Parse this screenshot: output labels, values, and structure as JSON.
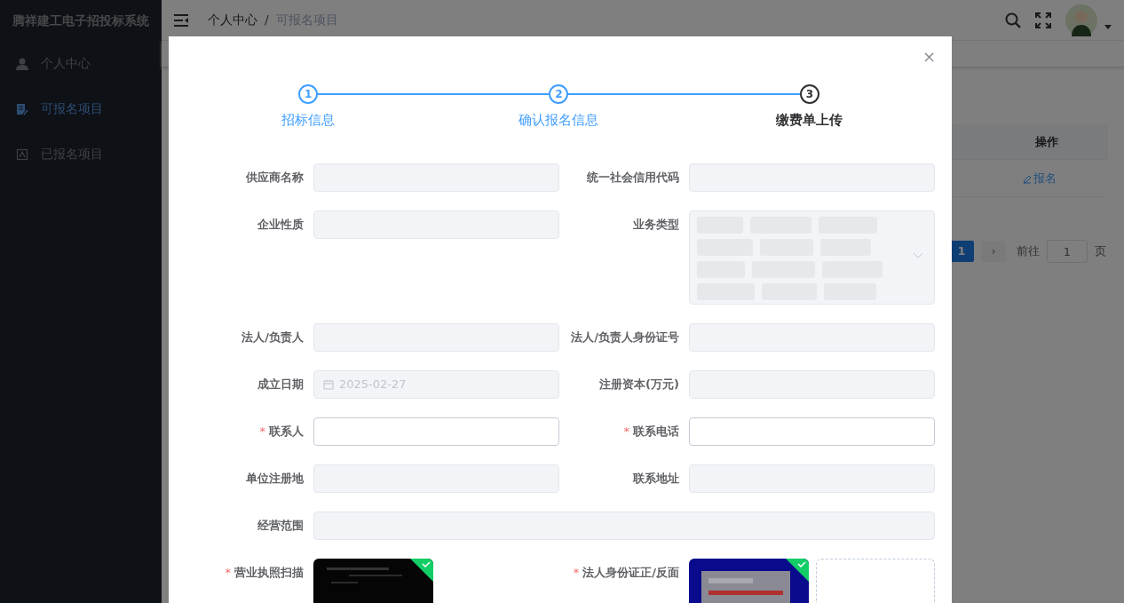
{
  "sidebar": {
    "title": "腾祥建工电子招投标系统",
    "items": [
      {
        "label": "个人中心",
        "selected": false
      },
      {
        "label": "可报名项目",
        "selected": true
      },
      {
        "label": "已报名项目",
        "selected": false
      }
    ]
  },
  "header": {
    "breadcrumb": [
      {
        "label": "个人中心",
        "current": false
      },
      {
        "label": "可报名项目",
        "current": true
      }
    ],
    "separator": "/"
  },
  "table": {
    "columns": [
      {
        "label": "操作"
      }
    ],
    "rows": [
      {
        "action": "报名"
      }
    ]
  },
  "pagination": {
    "pages": [
      {
        "label": "1",
        "selected": true
      }
    ],
    "next": "›",
    "goto_label": "前往",
    "goto_value": "1",
    "goto_suffix": "页"
  },
  "modal": {
    "close": "×",
    "steps": [
      {
        "number": "1",
        "label": "招标信息",
        "done": true,
        "active": false
      },
      {
        "number": "2",
        "label": "确认报名信息",
        "done": true,
        "active": false
      },
      {
        "number": "3",
        "label": "缴费单上传",
        "done": false,
        "active": true
      }
    ],
    "fields": [
      {
        "kind": "input",
        "label": "供应商名称",
        "disabled": true
      },
      {
        "kind": "input",
        "label": "统一社会信用代码",
        "disabled": true
      },
      {
        "kind": "input",
        "label": "企业性质",
        "disabled": true
      },
      {
        "kind": "multiselect",
        "label": "业务类型",
        "disabled": true
      },
      {
        "kind": "input",
        "label": "法人/负责人",
        "disabled": true
      },
      {
        "kind": "input",
        "label": "法人/负责人身份证号",
        "disabled": true
      },
      {
        "kind": "date",
        "label": "成立日期",
        "disabled": true,
        "value": "2025-02-27"
      },
      {
        "kind": "input",
        "label": "注册资本(万元)",
        "disabled": true
      },
      {
        "kind": "input",
        "label": "联系人",
        "required_mark": "*",
        "disabled": false
      },
      {
        "kind": "input",
        "label": "联系电话",
        "required_mark": "*",
        "disabled": false
      },
      {
        "kind": "input",
        "label": "单位注册地",
        "disabled": true
      },
      {
        "kind": "input",
        "label": "联系地址",
        "disabled": true
      },
      {
        "kind": "wide",
        "label": "经营范围",
        "disabled": true
      },
      {
        "kind": "upload",
        "label": "营业执照扫描",
        "required_mark": "*",
        "uploaded": true
      },
      {
        "kind": "upload",
        "label": "法人身份证正/反面",
        "required_mark": "*",
        "uploaded": true,
        "empty_slot": true
      }
    ]
  }
}
